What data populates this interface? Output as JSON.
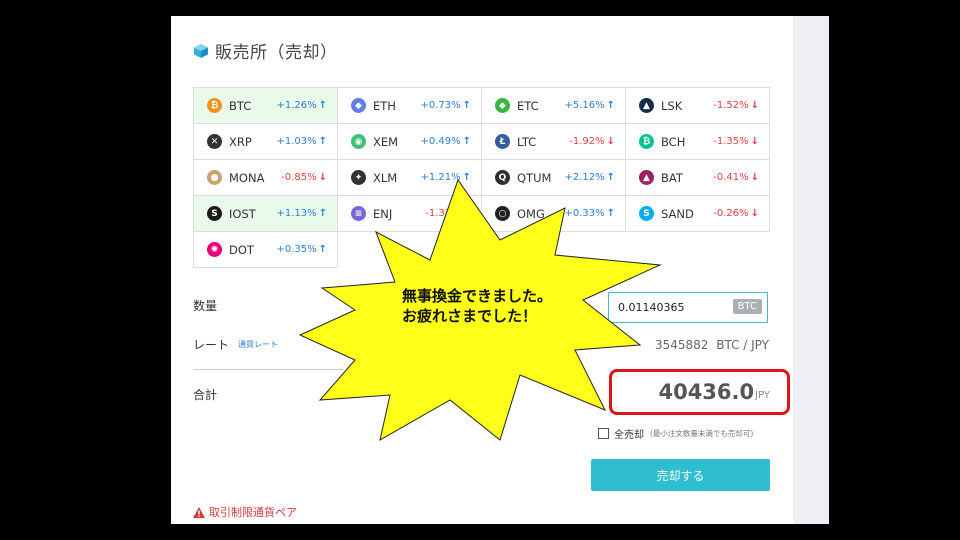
{
  "title": "販売所（売却）",
  "coins": [
    {
      "symbol": "BTC",
      "change": "+1.26%",
      "dir": "up",
      "color": "#f7931a",
      "glyph": "₿",
      "selected": true
    },
    {
      "symbol": "ETH",
      "change": "+0.73%",
      "dir": "up",
      "color": "#627eea",
      "glyph": "◆"
    },
    {
      "symbol": "ETC",
      "change": "+5.16%",
      "dir": "up",
      "color": "#3ab83a",
      "glyph": "◆"
    },
    {
      "symbol": "LSK",
      "change": "-1.52%",
      "dir": "down",
      "color": "#1a2b4b",
      "glyph": "▲"
    },
    {
      "symbol": "XRP",
      "change": "+1.03%",
      "dir": "up",
      "color": "#333333",
      "glyph": "✕"
    },
    {
      "symbol": "XEM",
      "change": "+0.49%",
      "dir": "up",
      "color": "#41bf76",
      "glyph": "◉"
    },
    {
      "symbol": "LTC",
      "change": "-1.92%",
      "dir": "down",
      "color": "#345d9d",
      "glyph": "Ł"
    },
    {
      "symbol": "BCH",
      "change": "-1.35%",
      "dir": "down",
      "color": "#0ac18e",
      "glyph": "₿"
    },
    {
      "symbol": "MONA",
      "change": "-0.85%",
      "dir": "down",
      "color": "#c9a46b",
      "glyph": "●"
    },
    {
      "symbol": "XLM",
      "change": "+1.21%",
      "dir": "up",
      "color": "#333333",
      "glyph": "✦"
    },
    {
      "symbol": "QTUM",
      "change": "+2.12%",
      "dir": "up",
      "color": "#2e2e2e",
      "glyph": "Q"
    },
    {
      "symbol": "BAT",
      "change": "-0.41%",
      "dir": "down",
      "color": "#9e1f63",
      "glyph": "▲"
    },
    {
      "symbol": "IOST",
      "change": "+1.13%",
      "dir": "up",
      "color": "#1c1c1c",
      "glyph": "S",
      "selected": true
    },
    {
      "symbol": "ENJ",
      "change": "-1.33%",
      "dir": "down",
      "color": "#7866d5",
      "glyph": "≡"
    },
    {
      "symbol": "OMG",
      "change": "+0.33%",
      "dir": "up",
      "color": "#222222",
      "glyph": "○"
    },
    {
      "symbol": "SAND",
      "change": "-0.26%",
      "dir": "down",
      "color": "#00adef",
      "glyph": "S"
    },
    {
      "symbol": "DOT",
      "change": "+0.35%",
      "dir": "up",
      "color": "#e6007a",
      "glyph": "✺"
    }
  ],
  "quantity": {
    "label": "数量",
    "value": "0.01140365",
    "unit": "BTC"
  },
  "rate": {
    "label": "レート",
    "sub_label": "通貨レート",
    "value": "3545882",
    "unit": "BTC / JPY"
  },
  "total": {
    "label": "合計",
    "value": "40436.0",
    "unit": "JPY"
  },
  "sell_all": {
    "label": "全売却",
    "note": "(最小注文数量未満でも売却可)"
  },
  "sell_button": "売却する",
  "restricted_link": "取引制限通貨ペア",
  "overlay_text": "無事換金できました。お疲れさまでした！",
  "colors": {
    "accent": "#2ebed0",
    "up": "#2a7fd4",
    "down": "#e04040",
    "highlight": "#e0131b",
    "burst": "#ffff1a"
  }
}
